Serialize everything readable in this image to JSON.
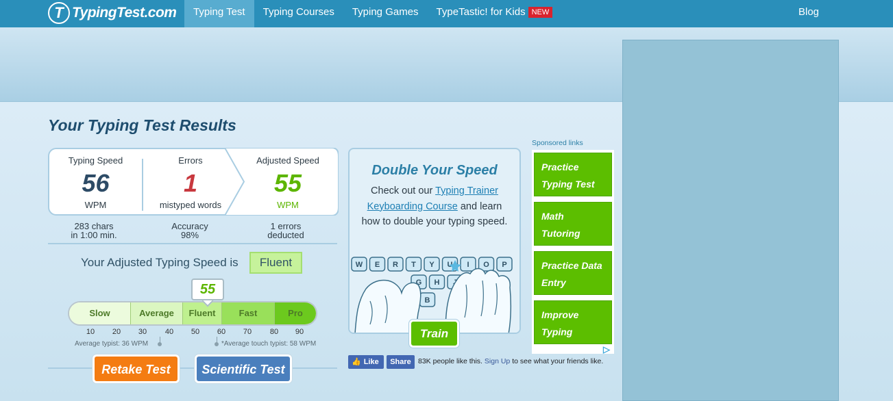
{
  "site": {
    "logo_letter": "T",
    "logo_text": "TypingTest.com"
  },
  "nav": {
    "items": [
      {
        "label": "Typing Test",
        "active": true
      },
      {
        "label": "Typing Courses",
        "active": false
      },
      {
        "label": "Typing Games",
        "active": false
      },
      {
        "label": "TypeTastic! for Kids",
        "active": false,
        "badge": "NEW"
      }
    ],
    "blog": "Blog"
  },
  "results": {
    "title": "Your Typing Test Results",
    "typing_speed": {
      "label": "Typing Speed",
      "value": "56",
      "unit": "WPM"
    },
    "errors": {
      "label": "Errors",
      "value": "1",
      "unit": "mistyped words"
    },
    "adjusted_speed": {
      "label": "Adjusted Speed",
      "value": "55",
      "unit": "WPM"
    },
    "chars": {
      "line1": "283 chars",
      "line2": "in 1:00 min."
    },
    "accuracy": {
      "line1": "Accuracy",
      "line2": "98%"
    },
    "deducted": {
      "line1": "1 errors",
      "line2": "deducted"
    },
    "adjusted_text": "Your Adjusted Typing Speed is",
    "level": "Fluent"
  },
  "scale": {
    "current_value": "55",
    "current_wpm": 55,
    "segments": [
      {
        "label": "Slow",
        "from": 0,
        "to": 23
      },
      {
        "label": "Average",
        "from": 23,
        "to": 40
      },
      {
        "label": "Fluent",
        "from": 40,
        "to": 54
      },
      {
        "label": "Fast",
        "from": 54,
        "to": 80
      },
      {
        "label": "Pro",
        "from": 80,
        "to": 100
      }
    ],
    "ticks": [
      "10",
      "20",
      "30",
      "40",
      "50",
      "60",
      "70",
      "80",
      "90"
    ],
    "average_typist": "Average typist: 36 WPM",
    "average_touch_typist": "*Average touch typist: 58 WPM"
  },
  "buttons": {
    "retake": "Retake Test",
    "scientific": "Scientific Test",
    "train": "Train"
  },
  "promo": {
    "title": "Double Your Speed",
    "text_before": "Check out our ",
    "link": "Typing Trainer Keyboarding Course",
    "text_after": " and learn how to double your typing speed.",
    "keys_row1": [
      "W",
      "E",
      "R",
      "T",
      "Y",
      "U",
      "I",
      "O",
      "P"
    ],
    "keys_row2": [
      "G",
      "H",
      "J"
    ],
    "keys_row3": [
      "V",
      "B"
    ]
  },
  "social": {
    "like": "Like",
    "share": "Share",
    "text": "83K people like this.",
    "signup": "Sign Up",
    "suffix": "to see what your friends like."
  },
  "sponsored": {
    "label": "Sponsored links",
    "items": [
      "Practice Typing Test",
      "Math Tutoring",
      "Practice Data Entry",
      "Improve Typing"
    ]
  },
  "colors": {
    "nav_bg": "#2a8fba",
    "speed_dark": "#2d4b66",
    "errors_red": "#c8383e",
    "adjusted_green": "#5cb500",
    "retake_orange": "#f47c12",
    "scientific_blue": "#4a7fbd",
    "sponsor_green": "#5cbe00"
  }
}
